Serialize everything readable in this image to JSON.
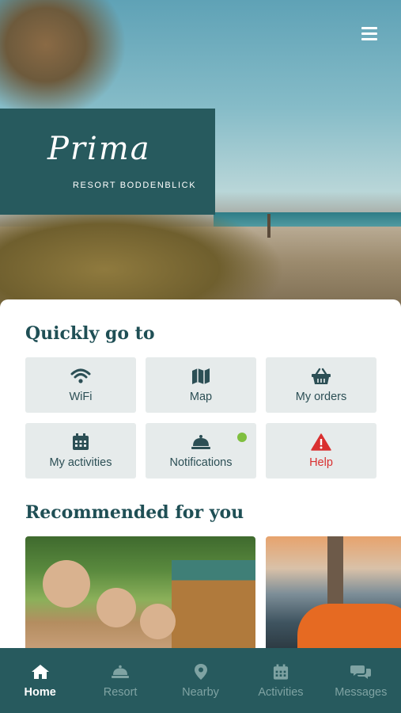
{
  "header": {
    "logo_script": "Prima",
    "logo_subtitle": "RESORT BODDENBLICK",
    "menu_icon": "hamburger-menu-icon"
  },
  "quick": {
    "title": "Quickly go to",
    "tiles": [
      {
        "label": "WiFi",
        "icon": "wifi-icon"
      },
      {
        "label": "Map",
        "icon": "map-icon"
      },
      {
        "label": "My orders",
        "icon": "basket-icon"
      },
      {
        "label": "My activities",
        "icon": "calendar-icon"
      },
      {
        "label": "Notifications",
        "icon": "bell-icon"
      },
      {
        "label": "Help",
        "icon": "warning-icon"
      }
    ]
  },
  "recommended": {
    "title": "Recommended for you"
  },
  "nav": {
    "items": [
      {
        "label": "Home",
        "icon": "home-icon",
        "active": true
      },
      {
        "label": "Resort",
        "icon": "service-bell-icon"
      },
      {
        "label": "Nearby",
        "icon": "location-pin-icon"
      },
      {
        "label": "Activities",
        "icon": "calendar-icon"
      },
      {
        "label": "Messages",
        "icon": "chat-icon"
      }
    ]
  },
  "colors": {
    "brand_teal": "#275a5e",
    "tile_bg": "#e6ebeb",
    "help_red": "#d93030",
    "notification_dot": "#7fbf3f"
  }
}
